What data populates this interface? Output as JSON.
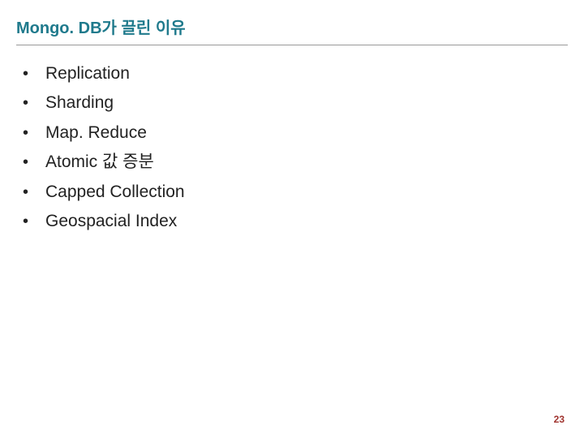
{
  "title": "Mongo. DB가 끌린 이유",
  "items": [
    "Replication",
    "Sharding",
    "Map. Reduce",
    "Atomic 값 증분",
    "Capped Collection",
    "Geospacial Index"
  ],
  "page_number": "23"
}
